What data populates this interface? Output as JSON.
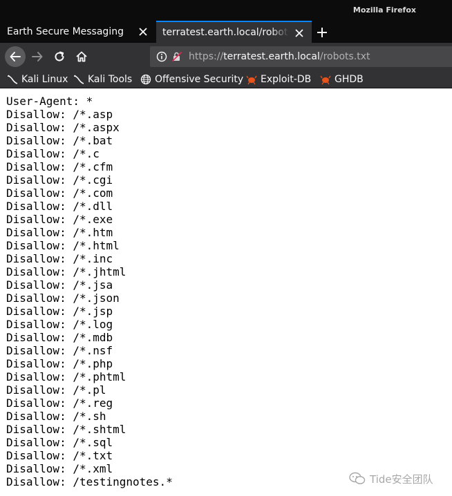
{
  "window": {
    "title": "Mozilla Firefox"
  },
  "tabs": [
    {
      "label": "Earth Secure Messaging",
      "active": false
    },
    {
      "label": "terratest.earth.local/robots.txt",
      "active": true
    }
  ],
  "urlbar": {
    "scheme": "https://",
    "host": "terratest.earth.local",
    "path": "/robots.txt"
  },
  "bookmarks": [
    {
      "label": "Kali Linux",
      "icon": "kali-dragon-icon"
    },
    {
      "label": "Kali Tools",
      "icon": "kali-dragon-icon"
    },
    {
      "label": "Offensive Security",
      "icon": "globe-icon"
    },
    {
      "label": "Exploit-DB",
      "icon": "exploit-db-bug-icon"
    },
    {
      "label": "GHDB",
      "icon": "exploit-db-bug-icon"
    }
  ],
  "robots_txt": "User-Agent: *\nDisallow: /*.asp\nDisallow: /*.aspx\nDisallow: /*.bat\nDisallow: /*.c\nDisallow: /*.cfm\nDisallow: /*.cgi\nDisallow: /*.com\nDisallow: /*.dll\nDisallow: /*.exe\nDisallow: /*.htm\nDisallow: /*.html\nDisallow: /*.inc\nDisallow: /*.jhtml\nDisallow: /*.jsa\nDisallow: /*.json\nDisallow: /*.jsp\nDisallow: /*.log\nDisallow: /*.mdb\nDisallow: /*.nsf\nDisallow: /*.php\nDisallow: /*.phtml\nDisallow: /*.pl\nDisallow: /*.reg\nDisallow: /*.sh\nDisallow: /*.shtml\nDisallow: /*.sql\nDisallow: /*.txt\nDisallow: /*.xml\nDisallow: /testingnotes.*",
  "watermark": {
    "text": "Tide安全团队"
  },
  "colors": {
    "chrome_dark": "#0c0c0d",
    "toolbar": "#323234",
    "urlbar_bg": "#474749",
    "active_tab_accent": "#0a84ff",
    "exploit_db_orange": "#e8531c"
  }
}
